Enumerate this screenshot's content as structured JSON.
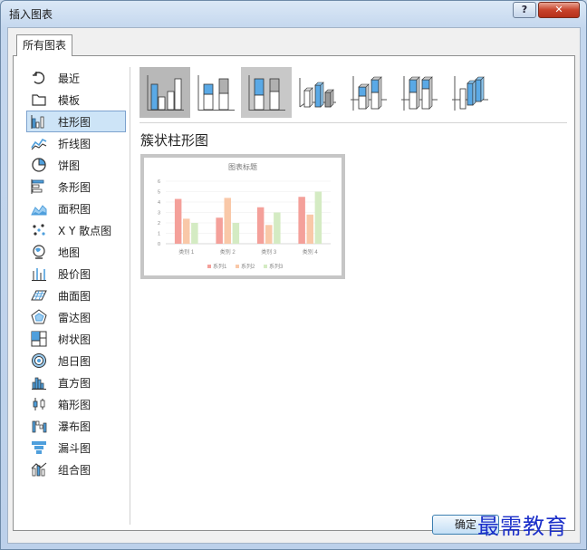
{
  "window": {
    "title": "插入图表",
    "help_label": "?",
    "close_label": "✕"
  },
  "tab": {
    "label": "所有图表"
  },
  "sidebar": {
    "items": [
      {
        "label": "最近",
        "icon": "recent-icon"
      },
      {
        "label": "模板",
        "icon": "folder-icon"
      },
      {
        "label": "柱形图",
        "icon": "column-chart-icon",
        "selected": true
      },
      {
        "label": "折线图",
        "icon": "line-chart-icon"
      },
      {
        "label": "饼图",
        "icon": "pie-chart-icon"
      },
      {
        "label": "条形图",
        "icon": "bar-chart-icon"
      },
      {
        "label": "面积图",
        "icon": "area-chart-icon"
      },
      {
        "label": "X Y 散点图",
        "icon": "scatter-chart-icon"
      },
      {
        "label": "地图",
        "icon": "map-chart-icon"
      },
      {
        "label": "股价图",
        "icon": "stock-chart-icon"
      },
      {
        "label": "曲面图",
        "icon": "surface-chart-icon"
      },
      {
        "label": "雷达图",
        "icon": "radar-chart-icon"
      },
      {
        "label": "树状图",
        "icon": "treemap-chart-icon"
      },
      {
        "label": "旭日图",
        "icon": "sunburst-chart-icon"
      },
      {
        "label": "直方图",
        "icon": "histogram-chart-icon"
      },
      {
        "label": "箱形图",
        "icon": "box-whisker-chart-icon"
      },
      {
        "label": "瀑布图",
        "icon": "waterfall-chart-icon"
      },
      {
        "label": "漏斗图",
        "icon": "funnel-chart-icon"
      },
      {
        "label": "组合图",
        "icon": "combo-chart-icon"
      }
    ]
  },
  "subtype": {
    "title": "簇状柱形图"
  },
  "preview": {
    "chart_data": {
      "type": "bar",
      "title": "图表标题",
      "categories": [
        "类别 1",
        "类别 2",
        "类别 3",
        "类别 4"
      ],
      "series": [
        {
          "name": "系列1",
          "values": [
            4.3,
            2.5,
            3.5,
            4.5
          ],
          "color": "#f4a09a"
        },
        {
          "name": "系列2",
          "values": [
            2.4,
            4.4,
            1.8,
            2.8
          ],
          "color": "#f9c8a8"
        },
        {
          "name": "系列3",
          "values": [
            2.0,
            2.0,
            3.0,
            5.0
          ],
          "color": "#d4ebc3"
        }
      ],
      "ylim": [
        0,
        6
      ],
      "yticks": [
        "0",
        "1",
        "2",
        "3",
        "4",
        "5",
        "6"
      ],
      "grid": true,
      "legend": "bottom"
    }
  },
  "buttons": {
    "ok_label": "确定"
  },
  "watermark": {
    "text": "最需教育"
  },
  "colors": {
    "accent": "#4f9fdc",
    "selection": "#cde4f7",
    "watermark": "#1b2fc9"
  }
}
